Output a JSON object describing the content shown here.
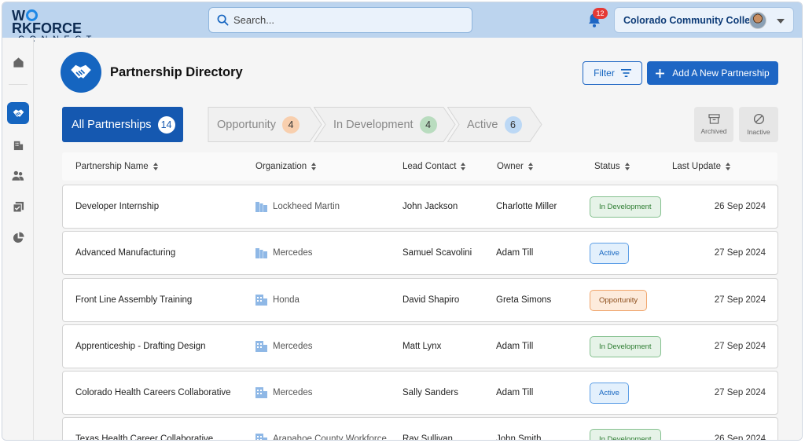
{
  "brand": {
    "line1_a": "W",
    "line1_b": "RKFORCE",
    "line2": "CONNECT"
  },
  "search": {
    "placeholder": "Search..."
  },
  "notifications": {
    "count": "12"
  },
  "org_selector": {
    "value": "Colorado Community College"
  },
  "page": {
    "title": "Partnership Directory"
  },
  "actions": {
    "filter_label": "Filter",
    "add_label": "Add A New Partnership"
  },
  "tabs": {
    "all": {
      "label": "All Partnerships",
      "count": "14"
    },
    "opportunity": {
      "label": "Opportunity",
      "count": "4"
    },
    "development": {
      "label": "In Development",
      "count": "4"
    },
    "active": {
      "label": "Active",
      "count": "6"
    }
  },
  "side_buttons": {
    "archived": "Archived",
    "inactive": "Inactive"
  },
  "table": {
    "headers": [
      "Partnership Name",
      "Organization",
      "Lead Contact",
      "Owner",
      "Status",
      "Last Update"
    ],
    "rows": [
      {
        "name": "Developer Internship",
        "org": "Lockheed Martin",
        "lead": "John Jackson",
        "owner": "Charlotte Miller",
        "status": "In Development",
        "date": "26 Sep 2024"
      },
      {
        "name": "Advanced Manufacturing",
        "org": "Mercedes",
        "lead": "Samuel Scavolini",
        "owner": "Adam Till",
        "status": "Active",
        "date": "27 Sep 2024"
      },
      {
        "name": "Front Line Assembly Training",
        "org": "Honda",
        "lead": "David Shapiro",
        "owner": "Greta Simons",
        "status": "Opportunity",
        "date": "27 Sep 2024"
      },
      {
        "name": "Apprenticeship - Drafting Design",
        "org": "Mercedes",
        "lead": "Matt Lynx",
        "owner": "Adam Till",
        "status": "In Development",
        "date": "27 Sep 2024"
      },
      {
        "name": "Colorado Health Careers Collaborative",
        "org": "Mercedes",
        "lead": "Sally Sanders",
        "owner": "Adam Till",
        "status": "Active",
        "date": "27 Sep 2024"
      },
      {
        "name": "Texas Health Career Collaborative",
        "org": "Arapahoe County Workforce",
        "lead": "Ray Sullivan",
        "owner": "John Smith",
        "status": "In Development",
        "date": "26 Sep 2024"
      }
    ]
  },
  "colors": {
    "primary": "#1565c0",
    "topbar": "#bcd4ee",
    "opportunity": "#f8cfae",
    "development": "#b9dcbf",
    "active": "#bcd8f5"
  },
  "icons": [
    "home-icon",
    "handshake-icon",
    "building-icon",
    "users-icon",
    "tasks-icon",
    "pie-chart-icon",
    "search-icon",
    "bell-icon",
    "filter-icon",
    "plus-icon",
    "archive-icon",
    "inactive-icon"
  ]
}
